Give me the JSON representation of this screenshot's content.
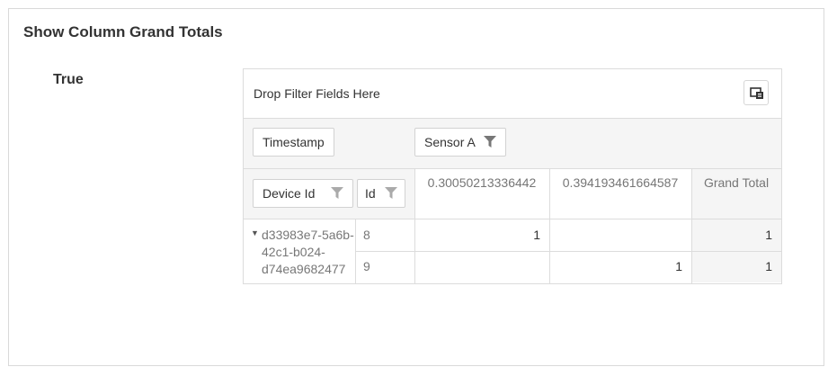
{
  "card": {
    "title": "Show Column Grand Totals"
  },
  "option": {
    "label": "True"
  },
  "pivot": {
    "filter_placeholder": "Drop Filter Fields Here",
    "column_fields": [
      "Timestamp"
    ],
    "data_field": "Sensor A",
    "row_fields": [
      "Device Id",
      "Id"
    ],
    "column_headers": [
      "0.30050213336442",
      "0.394193461664587",
      "Grand Total"
    ],
    "device_id": "d33983e7-5a6b-42c1-b024-d74ea9682477",
    "device_id_lines": [
      "d33983e7-5a6b-",
      "42c1-b024-",
      "d74ea9682477"
    ],
    "rows": [
      {
        "id": "8",
        "values": [
          "1",
          "",
          "1"
        ]
      },
      {
        "id": "9",
        "values": [
          "",
          "1",
          "1"
        ]
      }
    ]
  }
}
